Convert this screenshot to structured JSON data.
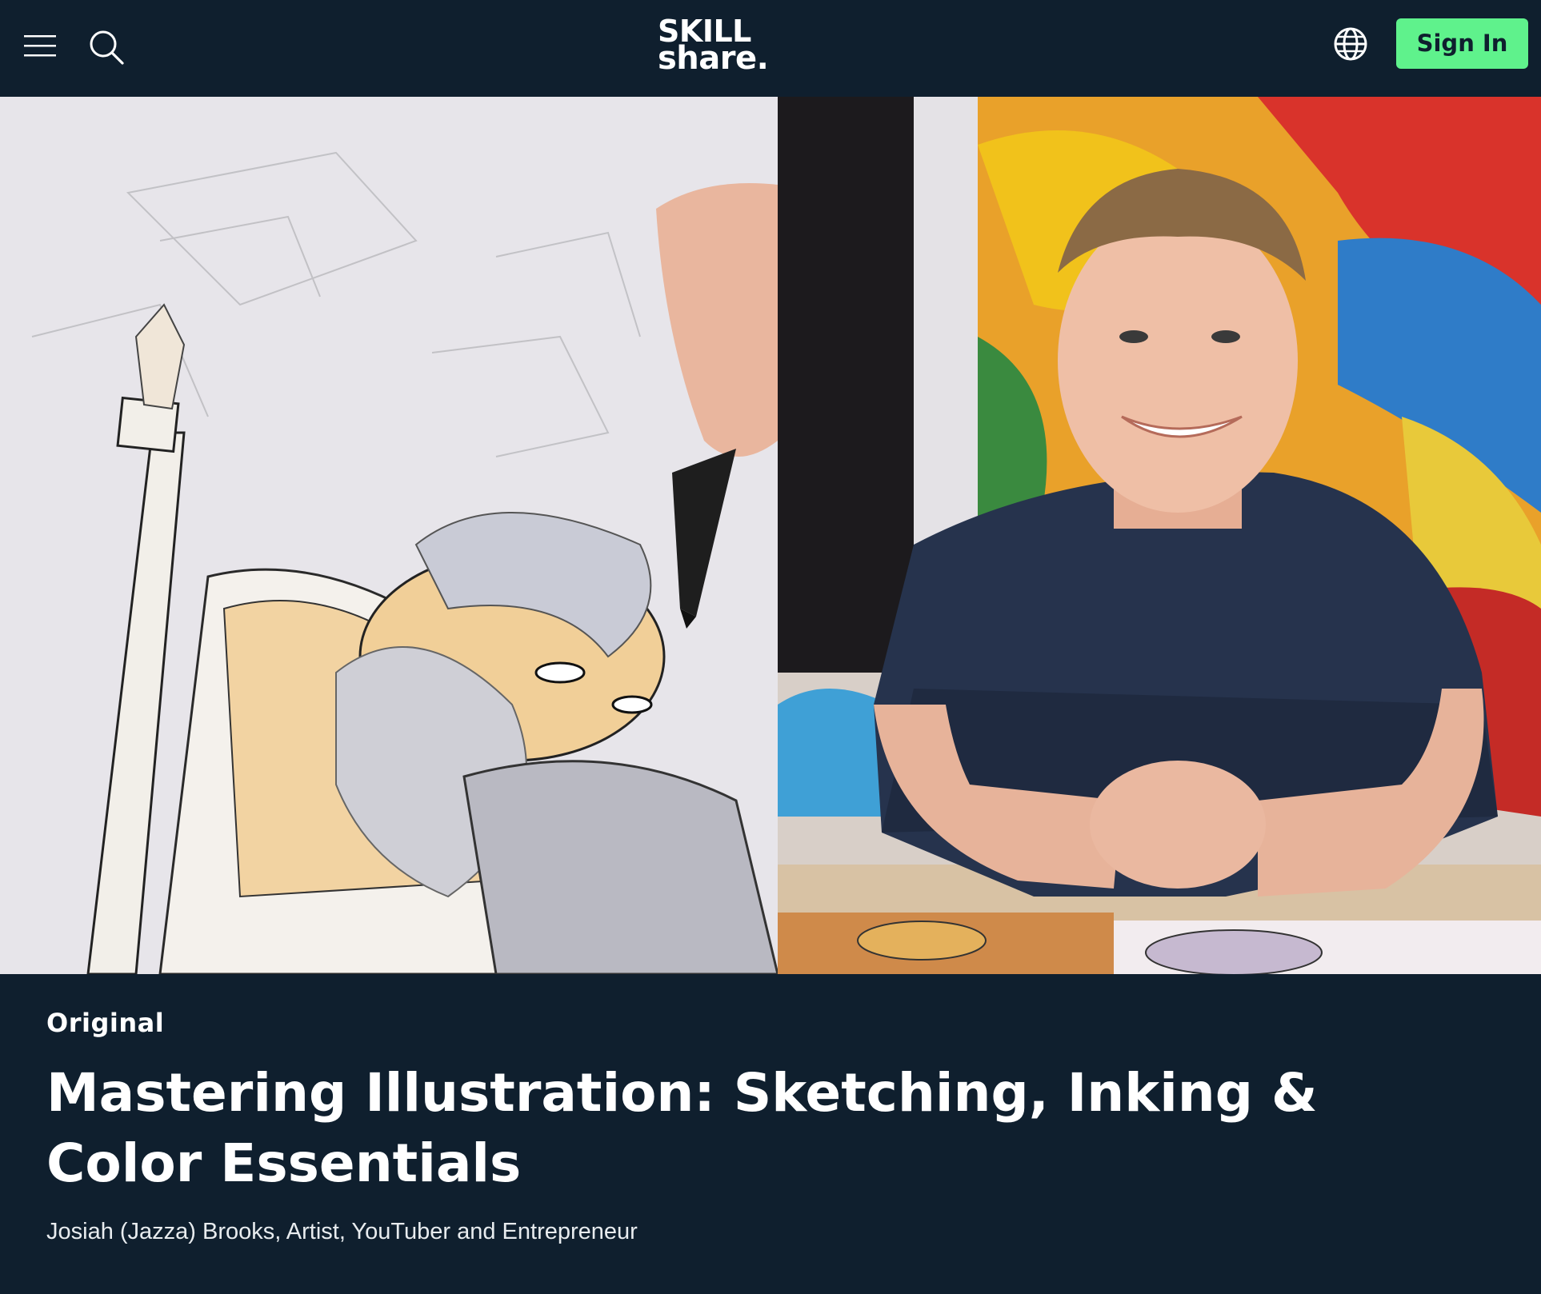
{
  "header": {
    "logo_line1": "SKILL",
    "logo_line2": "share.",
    "sign_in_label": "Sign In",
    "menu_icon": "hamburger-menu-icon",
    "search_icon": "search-icon",
    "language_icon": "globe-icon"
  },
  "hero": {
    "left_image": "illustration of a bearded warrior being inked with a marker pen",
    "right_image": "smiling instructor in a navy t-shirt seated at a table with colorful artwork behind him"
  },
  "course": {
    "badge": "Original",
    "title": "Mastering Illustration: Sketching, Inking & Color Essentials",
    "teacher": "Josiah (Jazza) Brooks, Artist, YouTuber and Entrepreneur"
  },
  "colors": {
    "background": "#0f1f2e",
    "accent": "#5ff28c",
    "text": "#ffffff"
  }
}
